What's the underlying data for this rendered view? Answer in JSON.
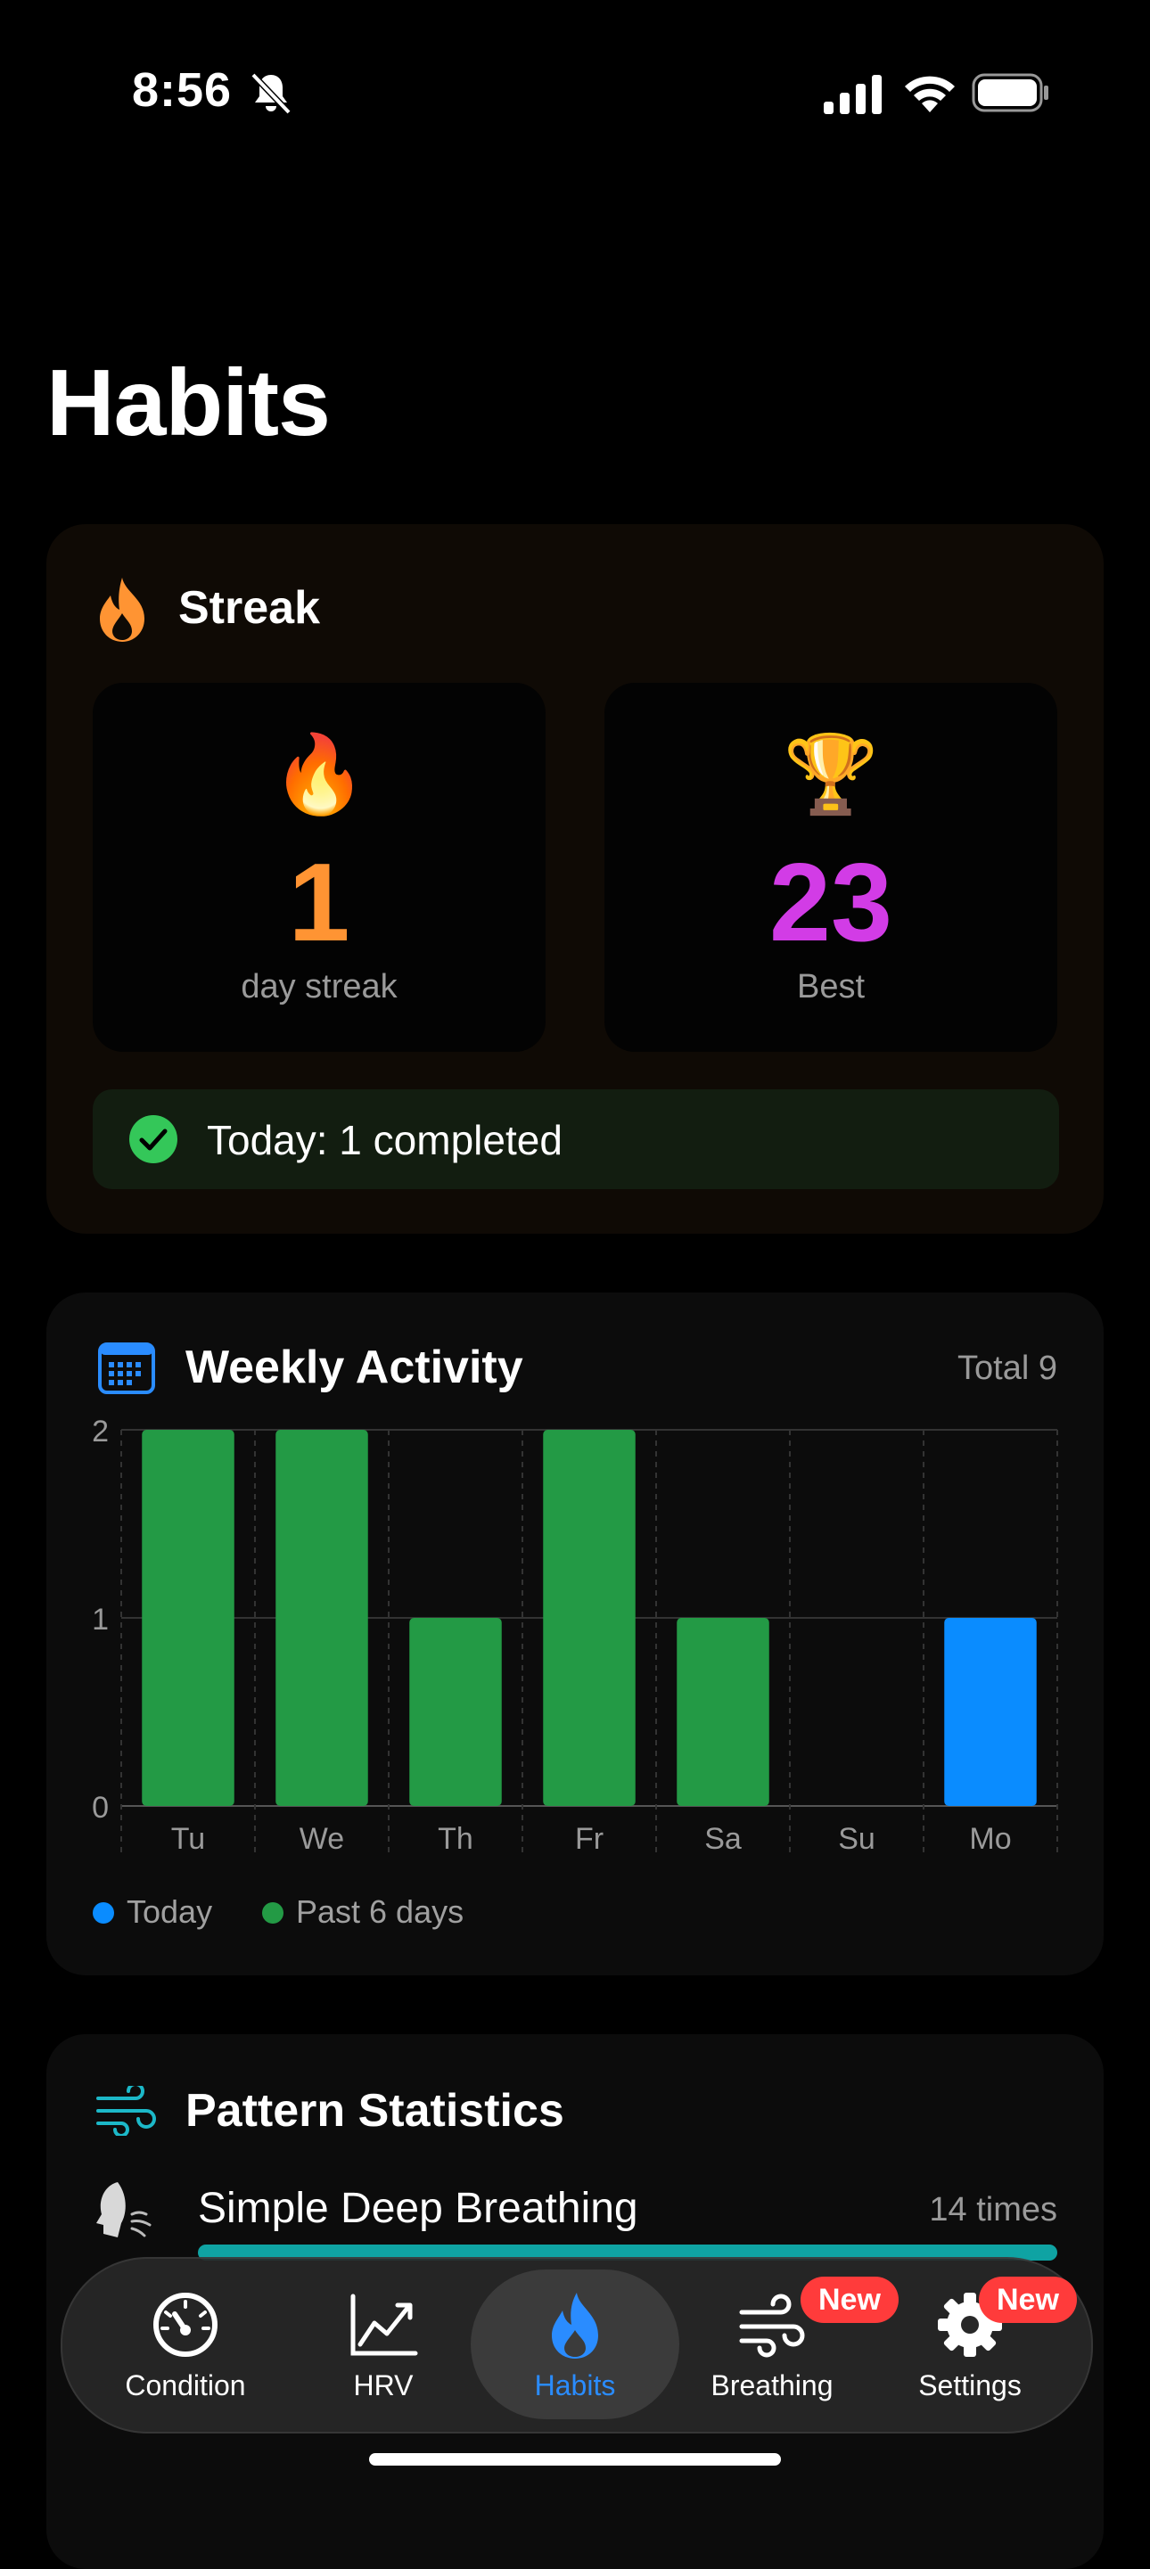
{
  "status_bar": {
    "time": "8:56"
  },
  "page_title": "Habits",
  "streak": {
    "title": "Streak",
    "current": {
      "value": "1",
      "label": "day streak"
    },
    "best": {
      "value": "23",
      "label": "Best"
    },
    "today": "Today: 1 completed"
  },
  "weekly": {
    "title": "Weekly Activity",
    "total": "Total 9",
    "legend": {
      "today": "Today",
      "past": "Past 6 days"
    }
  },
  "chart_data": {
    "type": "bar",
    "categories": [
      "Tu",
      "We",
      "Th",
      "Fr",
      "Sa",
      "Su",
      "Mo"
    ],
    "values": [
      2,
      2,
      1,
      2,
      1,
      0,
      1
    ],
    "highlight_index": 6,
    "ylim": [
      0,
      2
    ],
    "yticks": [
      "0",
      "1",
      "2"
    ],
    "colors": {
      "past": "#239a45",
      "today": "#0a8cff"
    },
    "grid": true
  },
  "patterns": {
    "title": "Pattern Statistics",
    "items": [
      {
        "name": "Simple Deep Breathing",
        "count": "14 times",
        "progress": 1.0
      }
    ]
  },
  "tabs": [
    {
      "label": "Condition",
      "icon": "gauge-icon"
    },
    {
      "label": "HRV",
      "icon": "chart-line-icon"
    },
    {
      "label": "Habits",
      "icon": "flame-icon",
      "active": true
    },
    {
      "label": "Breathing",
      "icon": "wind-icon",
      "badge": "New"
    },
    {
      "label": "Settings",
      "icon": "gear-icon",
      "badge": "New"
    }
  ],
  "colors": {
    "accent_orange": "#ff9433",
    "accent_purple": "#d23ce6",
    "accent_blue": "#2a8cff",
    "success": "#34c759"
  }
}
